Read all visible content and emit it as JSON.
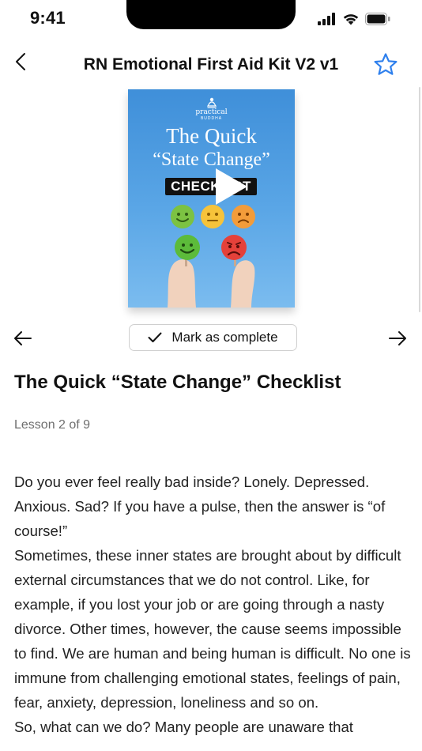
{
  "status_bar": {
    "time": "9:41"
  },
  "nav": {
    "title": "RN Emotional First Aid Kit V2 v1"
  },
  "video": {
    "brand_name": "practical",
    "brand_sub": "BUDDHA",
    "title_line1": "The Quick",
    "title_line2": "“State Change”",
    "badge": "CHECKLIST",
    "emoji_colors": {
      "green": "#7cc242",
      "yellow": "#f6c33a",
      "orange": "#f39c3a",
      "red": "#e5413a"
    }
  },
  "controls": {
    "mark_complete_label": "Mark as complete"
  },
  "lesson": {
    "title": "The Quick “State Change” Checklist",
    "progress": "Lesson 2 of 9",
    "paragraphs": [
      "Do you ever feel really bad inside? Lonely. Depressed. Anxious. Sad? If you have a pulse, then the answer is “of course!”",
      "Sometimes, these inner states are brought about by difficult external circumstances that we do not control. Like, for example, if you lost your job or are going through a nasty divorce. Other times, however, the cause seems impossible to find. We are human and being human is difficult. No one is immune from challenging emotional states, feelings of pain, fear, anxiety, depression, loneliness and so on.",
      "So, what can we do? Many people are unaware that"
    ]
  },
  "colors": {
    "accent": "#2f80ed",
    "text": "#111111",
    "muted": "#6e6e6e"
  }
}
